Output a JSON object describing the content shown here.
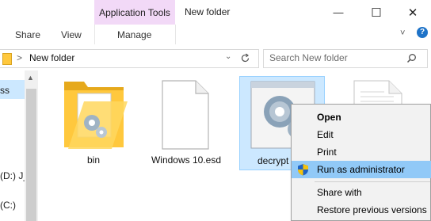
{
  "titlebar": {
    "context_tab": "Application Tools",
    "window_title": "New folder",
    "minimize": "—",
    "maximize": "☐",
    "close": "✕"
  },
  "ribbon": {
    "tabs": [
      "Share",
      "View",
      "Manage"
    ],
    "help": "?",
    "expand": "˅"
  },
  "address": {
    "path": "New folder",
    "separator": ">",
    "search_placeholder": "Search New folder"
  },
  "nav": {
    "items": [
      "ss",
      "(D:) J_",
      "(C:)"
    ]
  },
  "files": [
    {
      "name": "bin",
      "type": "folder"
    },
    {
      "name": "Windows 10.esd",
      "type": "file"
    },
    {
      "name": "decrypt",
      "type": "application"
    },
    {
      "name": "",
      "type": "file"
    }
  ],
  "context_menu": {
    "items": [
      {
        "label": "Open",
        "bold": true
      },
      {
        "label": "Edit"
      },
      {
        "label": "Print"
      },
      {
        "label": "Run as administrator",
        "icon": "uac-shield-icon",
        "highlighted": true
      },
      {
        "label": "Share with"
      },
      {
        "label": "Restore previous versions"
      }
    ]
  },
  "colors": {
    "context_tab_bg": "#f2d9f7",
    "selection_bg": "#cce8ff",
    "menu_highlight": "#91c9f7",
    "folder_yellow": "#ffc83d"
  }
}
